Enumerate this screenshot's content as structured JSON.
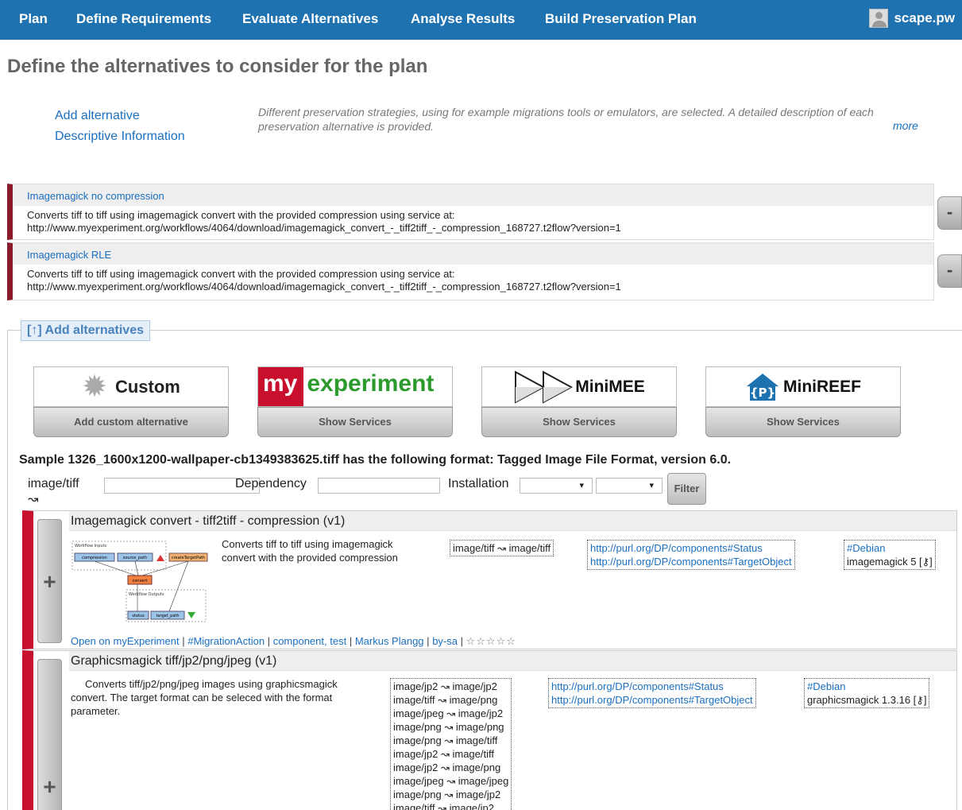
{
  "nav": {
    "items": [
      "Plan",
      "Define Requirements",
      "Evaluate Alternatives",
      "Analyse Results",
      "Build Preservation Plan"
    ],
    "user": "scape.pw"
  },
  "page_title": "Define the alternatives to consider for the plan",
  "side_links": {
    "add_alternative": "Add alternative",
    "descriptive_info": "Descriptive Information"
  },
  "intro": {
    "text": "Different preservation strategies, using for example migrations tools or emulators, are selected. A detailed description of each preservation alternative is provided.",
    "more": "more"
  },
  "alternatives": [
    {
      "name": "Imagemagick no compression",
      "line1": "Converts tiff to tiff using imagemagick convert with the provided compression using service at:",
      "line2": "http://www.myexperiment.org/workflows/4064/download/imagemagick_convert_-_tiff2tiff_-_compression_168727.t2flow?version=1",
      "remove": "-"
    },
    {
      "name": "Imagemagick RLE",
      "line1": "Converts tiff to tiff using imagemagick convert with the provided compression using service at:",
      "line2": "http://www.myexperiment.org/workflows/4064/download/imagemagick_convert_-_tiff2tiff_-_compression_168727.t2flow?version=1",
      "remove": "-"
    }
  ],
  "add_alternatives": {
    "legend": "[↑] Add alternatives",
    "sources": [
      {
        "logo_text": "Custom",
        "button": "Add custom alternative"
      },
      {
        "logo_my": "my",
        "logo_rest": "experiment",
        "button": "Show Services"
      },
      {
        "logo_text": "MiniMEE",
        "button": "Show Services"
      },
      {
        "logo_badge": "{P}",
        "logo_text": "MiniREEF",
        "button": "Show Services"
      }
    ]
  },
  "sample_info": "Sample 1326_1600x1200-wallpaper-cb1349383625.tiff has the following format: Tagged Image File Format, version 6.0.",
  "filters": {
    "migration_label": "image/tiff ↝",
    "migration_value": "",
    "dependency_label": "Dependency",
    "dependency_value": "",
    "installation_label": "Installation",
    "select1": "▾",
    "select2": "▾",
    "button": "Filter"
  },
  "results": [
    {
      "title": "Imagemagick convert - tiff2tiff - compression (v1)",
      "add": "+",
      "description": "Converts tiff to tiff using imagemagick convert with the provided compression",
      "migrations": [
        "image/tiff ↝ image/tiff"
      ],
      "purls": [
        "http://purl.org/DP/components#Status",
        "http://purl.org/DP/components#TargetObject"
      ],
      "env": {
        "tag": "#Debian",
        "pkg": "imagemagick 5 [⚷]"
      },
      "workflow": {
        "inputs_label": "Workflow Inputs",
        "outputs_label": "Workflow Outputs",
        "nodes": [
          "compression",
          "source_path",
          "createTargetPath",
          "convert",
          "status",
          "target_path"
        ]
      },
      "meta": {
        "open": "Open on myExperiment",
        "type": "#MigrationAction",
        "tags": "component, test",
        "author": "Markus Plangg",
        "license": "by-sa",
        "sep": "|",
        "stars": "☆☆☆☆☆"
      }
    },
    {
      "title": "Graphicsmagick tiff/jp2/png/jpeg (v1)",
      "add": "+",
      "description": "Converts tiff/jp2/png/jpeg images using graphicsmagick convert. The target format can be seleced with the format parameter.",
      "migrations": [
        "image/jp2 ↝ image/jp2",
        "image/tiff ↝ image/png",
        "image/jpeg ↝ image/jp2",
        "image/png ↝ image/png",
        "image/png ↝ image/tiff",
        "image/jp2 ↝ image/tiff",
        "image/jp2 ↝ image/png",
        "image/jpeg ↝ image/jpeg",
        "image/png ↝ image/jp2",
        "image/tiff ↝ image/jp2"
      ],
      "purls": [
        "http://purl.org/DP/components#Status",
        "http://purl.org/DP/components#TargetObject"
      ],
      "env": {
        "tag": "#Debian",
        "pkg": "graphicsmagick 1.3.16 [⚷]"
      }
    }
  ],
  "colors": {
    "nav": "#1f72b0",
    "alt_border": "#8b1a2b",
    "result_border": "#c8102e",
    "link": "#1a6fc0"
  }
}
